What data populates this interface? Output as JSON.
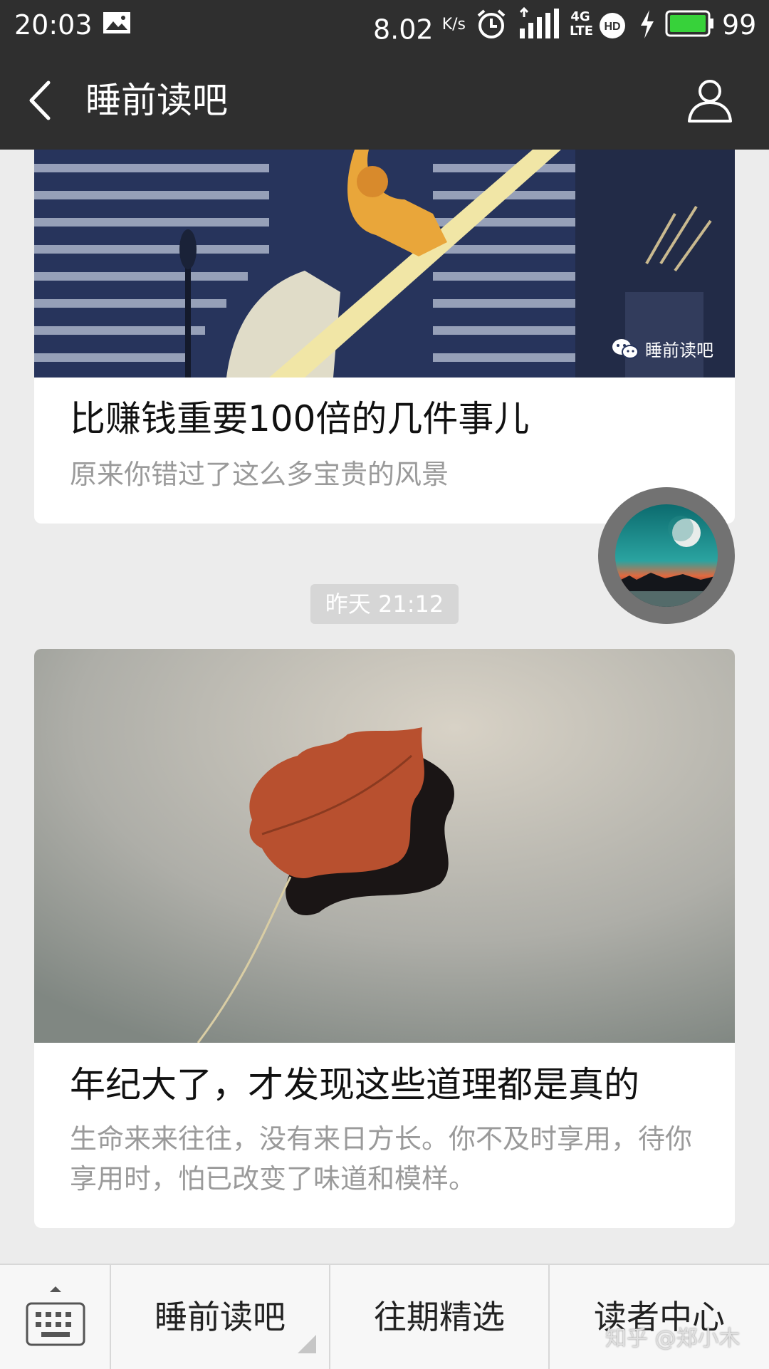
{
  "status_bar": {
    "time": "20:03",
    "net_speed": "8.02",
    "net_unit": "K/s",
    "network": "4G LTE",
    "battery": "99",
    "icons": [
      "image-icon",
      "alarm-icon",
      "signal-icon",
      "hd-icon",
      "charging-icon",
      "battery-icon"
    ],
    "battery_color": "#37d23a"
  },
  "header": {
    "title": "睡前读吧"
  },
  "articles": [
    {
      "watermark": "睡前读吧",
      "title": "比赚钱重要100倍的几件事儿",
      "subtitle": "原来你错过了这么多宝贵的风景"
    },
    {
      "title": "年纪大了，才发现这些道理都是真的",
      "subtitle": "生命来来往往，没有来日方长。你不及时享用，待你享用时，怕已改变了味道和模样。"
    }
  ],
  "timestamp": "昨天 21:12",
  "bottom_menu": {
    "items": [
      "睡前读吧",
      "往期精选",
      "读者中心"
    ]
  },
  "overlay_watermark": "知乎 @郑小木"
}
